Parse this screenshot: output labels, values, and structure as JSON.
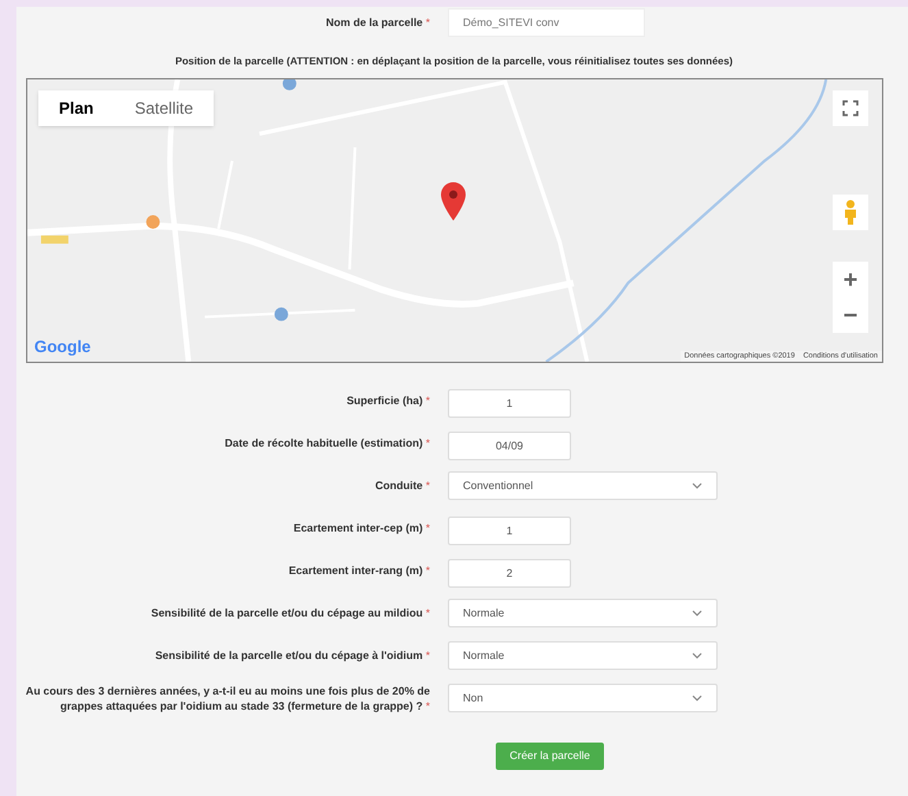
{
  "name_field": {
    "label": "Nom de la parcelle",
    "required_mark": "*",
    "value": "Démo_SITEVI conv"
  },
  "map_heading": "Position de la parcelle (ATTENTION : en déplaçant la position de la parcelle, vous réinitialisez toutes ses données)",
  "map": {
    "kind": "picture",
    "map_types": [
      {
        "label": "Plan",
        "selected": true
      },
      {
        "label": "Satellite",
        "selected": false
      }
    ],
    "logo": "Google",
    "attribution": "Données cartographiques ©2019",
    "terms": "Conditions d'utilisation",
    "zoom_in": "+",
    "zoom_out": "−"
  },
  "fields": [
    {
      "kind": "text",
      "label": "Superficie (ha)",
      "required_mark": "*",
      "value": "1"
    },
    {
      "kind": "text",
      "label": "Date de récolte habituelle (estimation)",
      "required_mark": "*",
      "value": "04/09"
    },
    {
      "kind": "select",
      "label": "Conduite",
      "required_mark": "*",
      "value": "Conventionnel"
    },
    {
      "kind": "text",
      "label": "Ecartement inter-cep (m)",
      "required_mark": "*",
      "value": "1"
    },
    {
      "kind": "text",
      "label": "Ecartement inter-rang (m)",
      "required_mark": "*",
      "value": "2"
    },
    {
      "kind": "select",
      "label": "Sensibilité de la parcelle et/ou du cépage au mildiou",
      "required_mark": "*",
      "value": "Normale"
    },
    {
      "kind": "select",
      "label": "Sensibilité de la parcelle et/ou du cépage à l'oidium",
      "required_mark": "*",
      "value": "Normale"
    },
    {
      "kind": "select",
      "label": "Au cours des 3 dernières années, y a-t-il eu au moins une fois plus de 20% de grappes attaquées par l'oidium au stade 33 (fermeture de la grappe) ?",
      "required_mark": "*",
      "value": "Non"
    }
  ],
  "submit_button": "Créer la parcelle"
}
